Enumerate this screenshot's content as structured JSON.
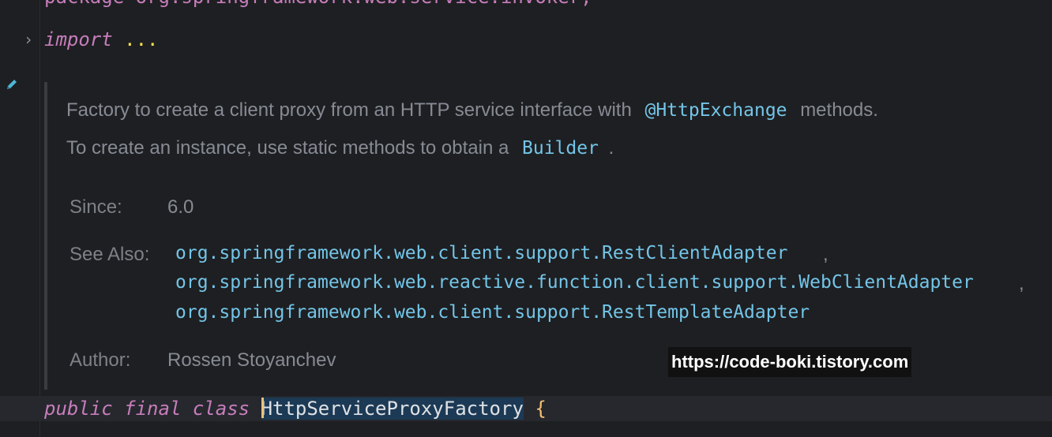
{
  "editor": {
    "top_partial_line": "package org.springframework.web.service.invoker;",
    "fold_arrow": "›",
    "import_keyword": "import",
    "import_dots": "...",
    "pencil_icon": "pencil-icon"
  },
  "doc": {
    "line1_pre": "Factory to create a client proxy from an HTTP service interface with",
    "line1_code": "@HttpExchange",
    "line1_post": "methods.",
    "line2_pre": "To create an instance, use static methods to obtain a",
    "line2_code": "Builder",
    "line2_post": ".",
    "since_label": "Since:",
    "since_value": "6.0",
    "see_also_label": "See Also:",
    "see_also": [
      "org.springframework.web.client.support.RestClientAdapter",
      "org.springframework.web.reactive.function.client.support.WebClientAdapter",
      "org.springframework.web.client.support.RestTemplateAdapter"
    ],
    "comma": ",",
    "author_label": "Author:",
    "author_value": "Rossen Stoyanchev"
  },
  "code": {
    "kw_public": "public",
    "kw_final": "final",
    "kw_class": "class",
    "class_name": "HttpServiceProxyFactory",
    "brace": "{"
  },
  "watermark": "https://code-boki.tistory.com",
  "colors": {
    "background": "#1e1f22",
    "keyword": "#c77dbb",
    "link": "#73c5e8",
    "doc_text": "#868b94"
  }
}
